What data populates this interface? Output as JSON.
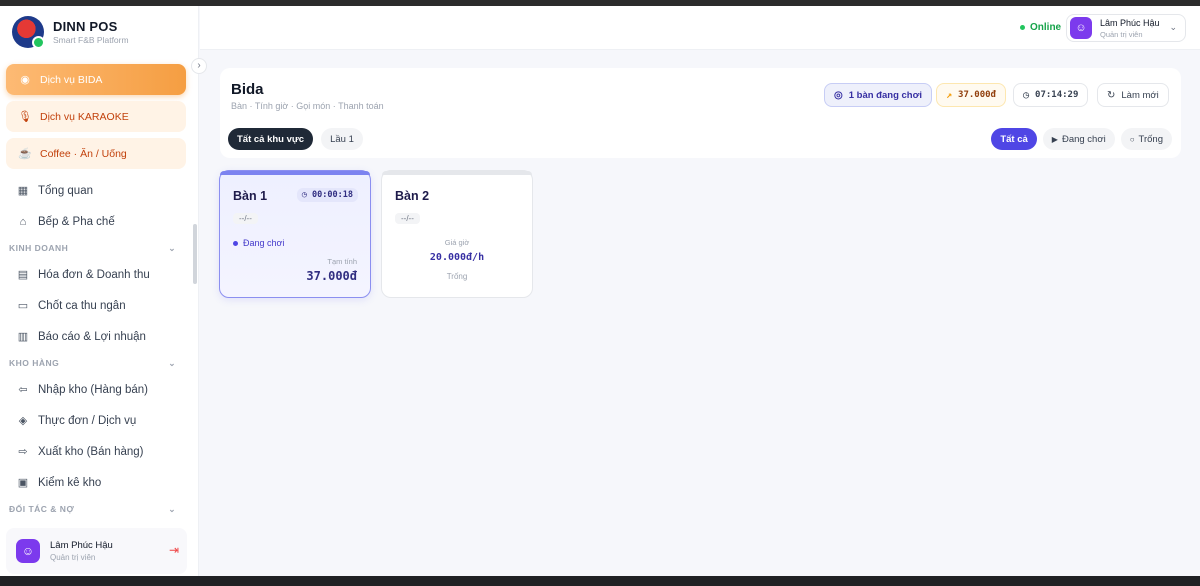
{
  "brand": {
    "title": "DINN POS",
    "subtitle": "Smart F&B Platform"
  },
  "sidebar": {
    "services": [
      {
        "label": "Dịch vụ BIDA",
        "icon": "billiard-icon",
        "active": true
      },
      {
        "label": "Dịch vụ KARAOKE",
        "icon": "microphone-icon",
        "active": false
      },
      {
        "label": "Coffee · Ăn / Uống",
        "icon": "coffee-icon",
        "active": false
      }
    ],
    "main_items": [
      {
        "label": "Tổng quan",
        "icon": "dashboard-icon"
      },
      {
        "label": "Bếp & Pha chế",
        "icon": "chef-icon"
      }
    ],
    "sections": [
      {
        "title": "KINH DOANH",
        "items": [
          {
            "label": "Hóa đơn & Doanh thu",
            "icon": "invoice-icon"
          },
          {
            "label": "Chốt ca thu ngân",
            "icon": "register-icon"
          },
          {
            "label": "Báo cáo & Lợi nhuận",
            "icon": "chart-icon"
          }
        ]
      },
      {
        "title": "KHO HÀNG",
        "items": [
          {
            "label": "Nhập kho (Hàng bán)",
            "icon": "import-icon"
          },
          {
            "label": "Thực đơn / Dịch vụ",
            "icon": "box-icon"
          },
          {
            "label": "Xuất kho (Bán hàng)",
            "icon": "export-icon"
          },
          {
            "label": "Kiểm kê kho",
            "icon": "clipboard-icon"
          }
        ]
      },
      {
        "title": "ĐỐI TÁC & NỢ",
        "items": []
      }
    ]
  },
  "user": {
    "name": "Lâm Phúc Hậu",
    "role": "Quản trị viên"
  },
  "header": {
    "status": "Online"
  },
  "page": {
    "title": "Bida",
    "subtitle": "Bàn · Tính giờ · Gọi món · Thanh toán",
    "stats": {
      "playing": "1 bàn đang chơi",
      "revenue": "37.000đ",
      "clock": "07:14:29",
      "refresh": "Làm mới"
    },
    "areas": [
      "Tất cả khu vực",
      "Lầu 1"
    ],
    "status_filters": [
      "Tất cả",
      "Đang chơi",
      "Trống"
    ]
  },
  "tables": [
    {
      "name": "Bàn 1",
      "timer": "00:00:18",
      "dash": "--/--",
      "status": "Đang chơi",
      "estimate_label": "Tạm tính",
      "estimate": "37.000đ"
    },
    {
      "name": "Bàn 2",
      "dash": "--/--",
      "price_label": "Giá giờ",
      "price": "20.000đ/h",
      "status": "Trống"
    }
  ],
  "colors": {
    "accent": "#4f46e5",
    "service_active": "#f59e42",
    "online": "#16a34a"
  }
}
